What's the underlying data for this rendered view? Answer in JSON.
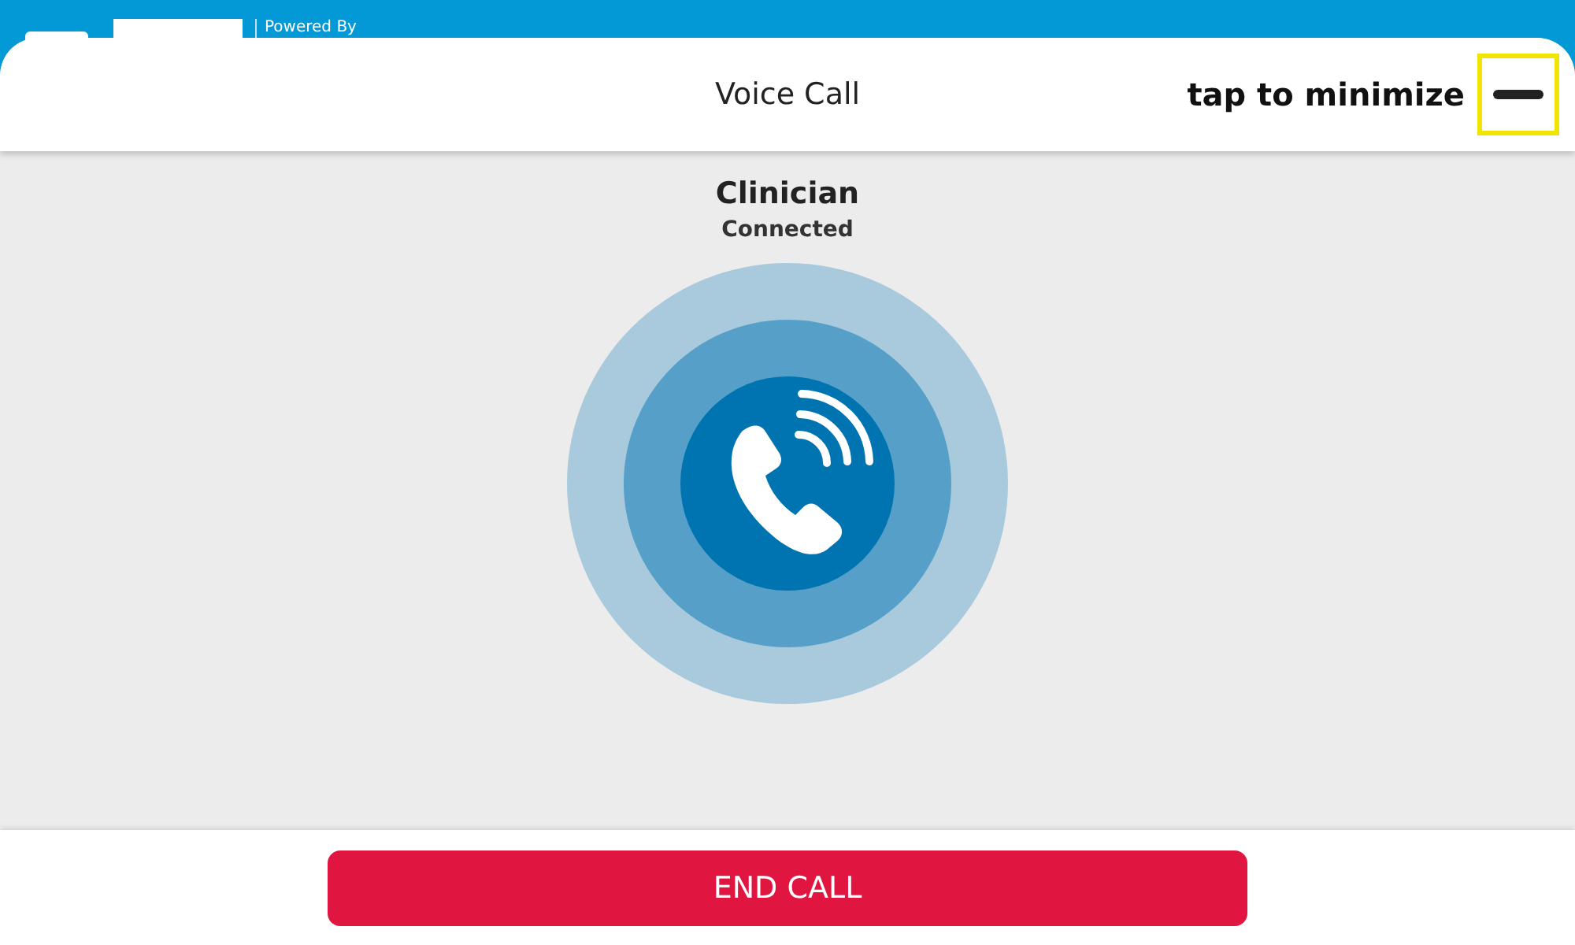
{
  "top_bar": {
    "powered_by": "Powered By"
  },
  "header": {
    "title": "Voice Call",
    "minimize_hint": "tap to minimize"
  },
  "call": {
    "name": "Clinician",
    "status": "Connected"
  },
  "footer": {
    "end_button": "END CALL"
  }
}
